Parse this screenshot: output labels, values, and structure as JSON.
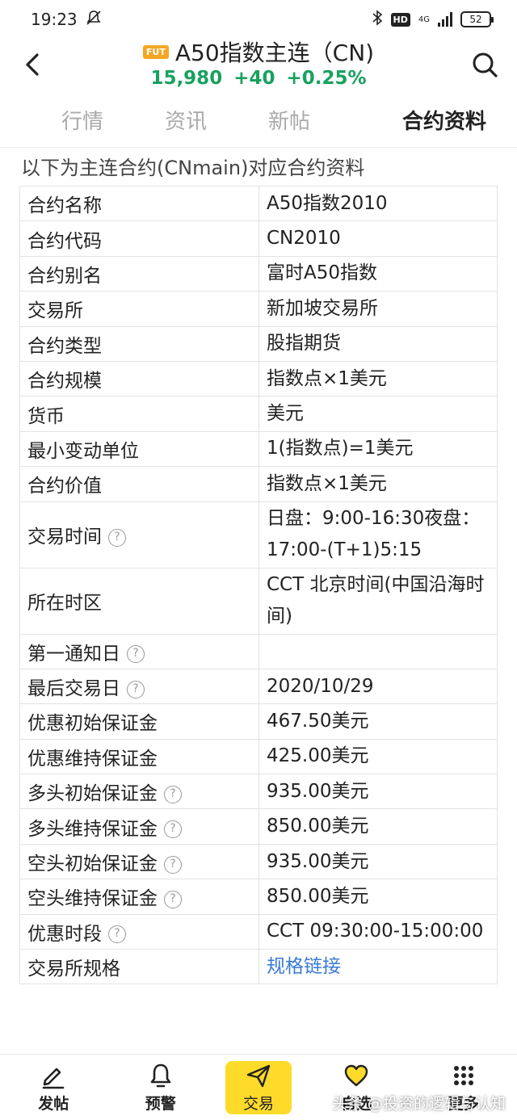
{
  "status_bar": {
    "time": "19:23",
    "hd": "HD",
    "network": "4G",
    "battery": "52"
  },
  "header": {
    "badge": "FUT",
    "title": "A50指数主连（CN)",
    "price": "15,980",
    "change": "+40",
    "change_pct": "+0.25%",
    "quote_color": "#19a15f"
  },
  "tabs": [
    {
      "label": "行情"
    },
    {
      "label": "资讯"
    },
    {
      "label": "新帖"
    },
    {
      "label": "合约资料"
    }
  ],
  "intro": "以下为主连合约(CNmain)对应合约资料",
  "rows": [
    {
      "key": "合约名称",
      "value": "A50指数2010"
    },
    {
      "key": "合约代码",
      "value": "CN2010"
    },
    {
      "key": "合约别名",
      "value": "富时A50指数"
    },
    {
      "key": "交易所",
      "value": "新加坡交易所"
    },
    {
      "key": "合约类型",
      "value": "股指期货"
    },
    {
      "key": "合约规模",
      "value": "指数点×1美元"
    },
    {
      "key": "货币",
      "value": "美元"
    },
    {
      "key": "最小变动单位",
      "value": "1(指数点)=1美元"
    },
    {
      "key": "合约价值",
      "value": "指数点×1美元"
    },
    {
      "key": "交易时间",
      "value": "日盘：9:00-16:30夜盘：17:00-(T+1)5:15"
    },
    {
      "key": "所在时区",
      "value": "CCT 北京时间(中国沿海时间)"
    },
    {
      "key": "第一通知日",
      "value": ""
    },
    {
      "key": "最后交易日",
      "value": "2020/10/29"
    },
    {
      "key": "优惠初始保证金",
      "value": "467.50美元"
    },
    {
      "key": "优惠维持保证金",
      "value": "425.00美元"
    },
    {
      "key": "多头初始保证金",
      "value": "935.00美元"
    },
    {
      "key": "多头维持保证金",
      "value": "850.00美元"
    },
    {
      "key": "空头初始保证金",
      "value": "935.00美元"
    },
    {
      "key": "空头维持保证金",
      "value": "850.00美元"
    },
    {
      "key": "优惠时段",
      "value": "CCT 09:30:00-15:00:00"
    },
    {
      "key": "交易所规格",
      "value": "规格链接"
    }
  ],
  "help_icon": "?",
  "bottom_nav": [
    {
      "label": "发帖",
      "icon": "pen-icon"
    },
    {
      "label": "预警",
      "icon": "bell-icon"
    },
    {
      "label": "交易",
      "icon": "send-icon"
    },
    {
      "label": "自选",
      "icon": "heart-icon"
    },
    {
      "label": "更多",
      "icon": "grid-icon"
    }
  ],
  "watermark": "头条 @投资的逻辑与认知",
  "colors": {
    "accent": "#fedb2a",
    "link": "#3a7bd5",
    "up": "#19a15f",
    "fut_badge": "#f5a623"
  }
}
